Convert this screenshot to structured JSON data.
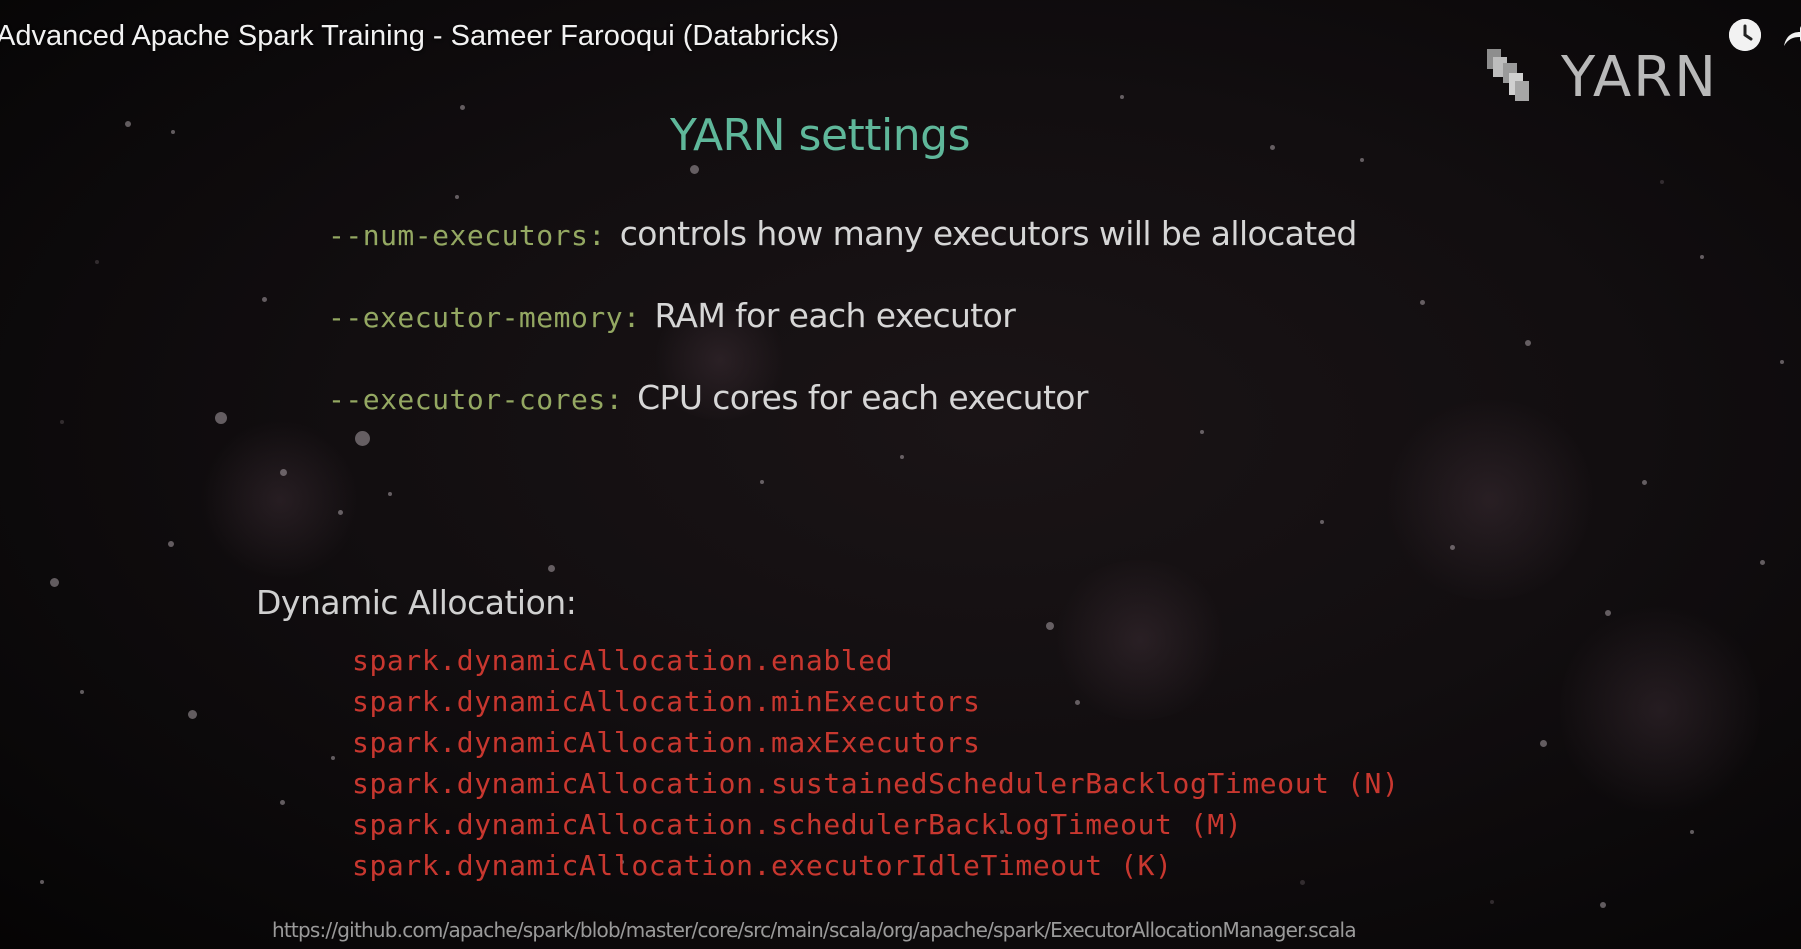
{
  "video": {
    "title": "Advanced Apache Spark Training - Sameer Farooqui (Databricks)",
    "watch_later_icon": "clock-icon",
    "share_icon": "share-arrow-icon"
  },
  "slide": {
    "logo_text": "YARN",
    "title": "YARN settings",
    "settings": [
      {
        "key": "--num-executors:",
        "description": "controls how many executors will be allocated"
      },
      {
        "key": "--executor-memory:",
        "description": "RAM for each executor"
      },
      {
        "key": "--executor-cores:",
        "description": "CPU cores for each executor"
      }
    ],
    "dynamic_allocation": {
      "heading": "Dynamic Allocation:",
      "properties": [
        "spark.dynamicAllocation.enabled",
        "spark.dynamicAllocation.minExecutors",
        "spark.dynamicAllocation.maxExecutors",
        "spark.dynamicAllocation.sustainedSchedulerBacklogTimeout (N)",
        "spark.dynamicAllocation.schedulerBacklogTimeout (M)",
        "spark.dynamicAllocation.executorIdleTimeout (K)"
      ]
    },
    "source_url": "https://github.com/apache/spark/blob/master/core/src/main/scala/org/apache/spark/ExecutorAllocationManager.scala"
  },
  "colors": {
    "title": "#5fb79a",
    "setting_key": "#94a862",
    "setting_desc": "#d6d6d6",
    "property": "#c8372f",
    "background": "#120e10"
  }
}
